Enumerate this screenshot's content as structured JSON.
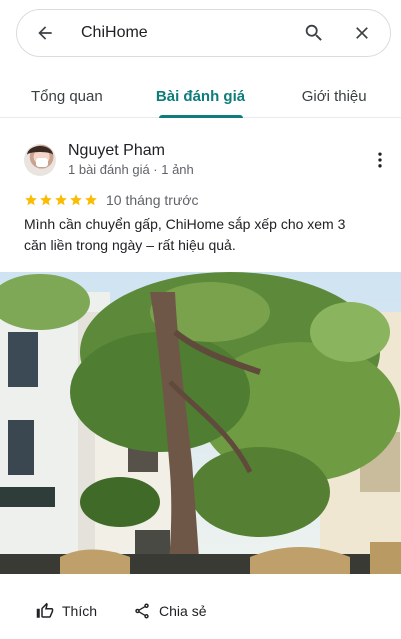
{
  "search": {
    "value": "ChiHome",
    "icons": {
      "back": "arrow-left-icon",
      "search": "search-icon",
      "clear": "close-icon"
    }
  },
  "tabs": [
    {
      "label": "Tổng quan",
      "active": false
    },
    {
      "label": "Bài đánh giá",
      "active": true
    },
    {
      "label": "Giới thiệu",
      "active": false
    }
  ],
  "review": {
    "author": "Nguyet Pham",
    "meta": "1 bài đánh giá · 1 ảnh",
    "rating": 5,
    "time": "10 tháng trước",
    "text": "Mình cần chuyển gấp, ChiHome sắp xếp cho xem 3 căn liền trong ngày – rất hiệu quả."
  },
  "actions": {
    "like": "Thích",
    "share": "Chia sẻ"
  },
  "colors": {
    "accent": "#0e7c7b",
    "star": "#fbbc04",
    "muted": "#5f6368"
  }
}
